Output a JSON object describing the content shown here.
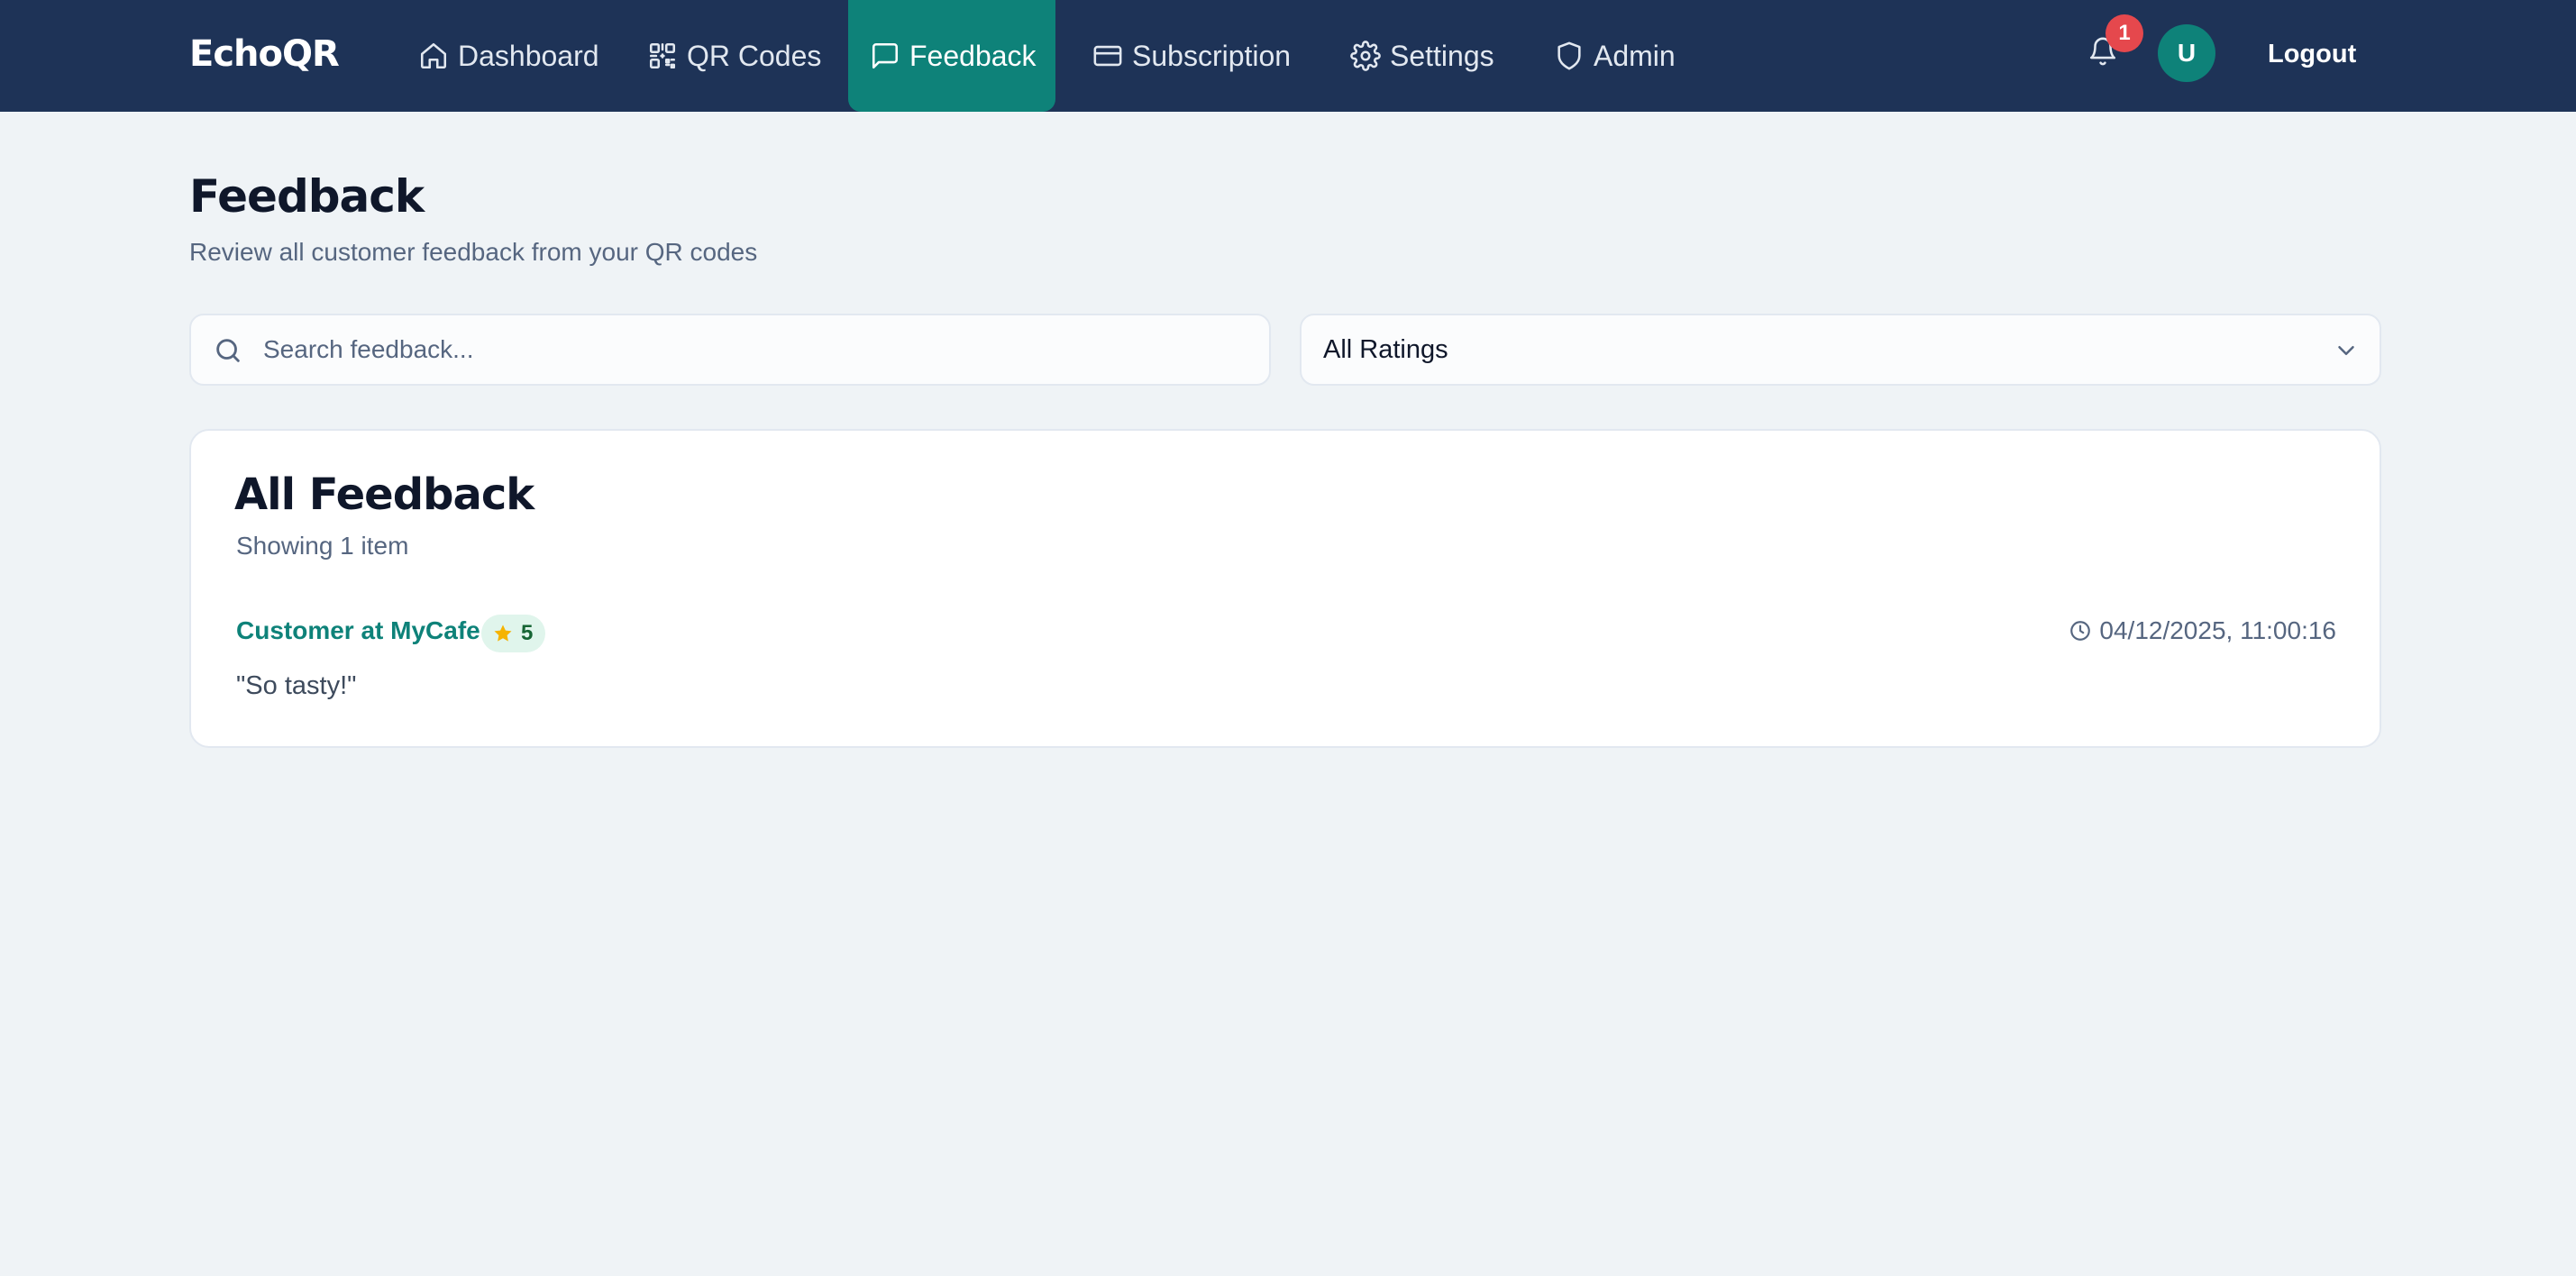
{
  "app": {
    "brand": "EchoQR"
  },
  "nav": {
    "items": [
      {
        "label": "Dashboard",
        "icon": "home-icon"
      },
      {
        "label": "QR Codes",
        "icon": "qr-code-icon"
      },
      {
        "label": "Feedback",
        "icon": "message-square-icon",
        "active": true
      },
      {
        "label": "Subscription",
        "icon": "credit-card-icon"
      },
      {
        "label": "Settings",
        "icon": "gear-icon"
      },
      {
        "label": "Admin",
        "icon": "shield-icon"
      }
    ],
    "notifications": {
      "count": "1",
      "icon": "bell-icon"
    },
    "avatar_initial": "U",
    "logout_label": "Logout"
  },
  "page": {
    "title": "Feedback",
    "subtitle": "Review all customer feedback from your QR codes"
  },
  "filters": {
    "search": {
      "placeholder": "Search feedback...",
      "value": ""
    },
    "rating": {
      "selected": "All Ratings"
    }
  },
  "feedback_list": {
    "title": "All Feedback",
    "count_text": "Showing 1 item",
    "items": [
      {
        "source": "Customer at MyCafe",
        "rating": "5",
        "timestamp": "04/12/2025, 11:00:16",
        "comment": "\"So tasty!\""
      }
    ]
  },
  "colors": {
    "nav_bg": "#1e3357",
    "accent": "#0e8279",
    "badge_red": "#e5484d",
    "page_bg": "#eff3f6",
    "star": "#f5b301"
  }
}
